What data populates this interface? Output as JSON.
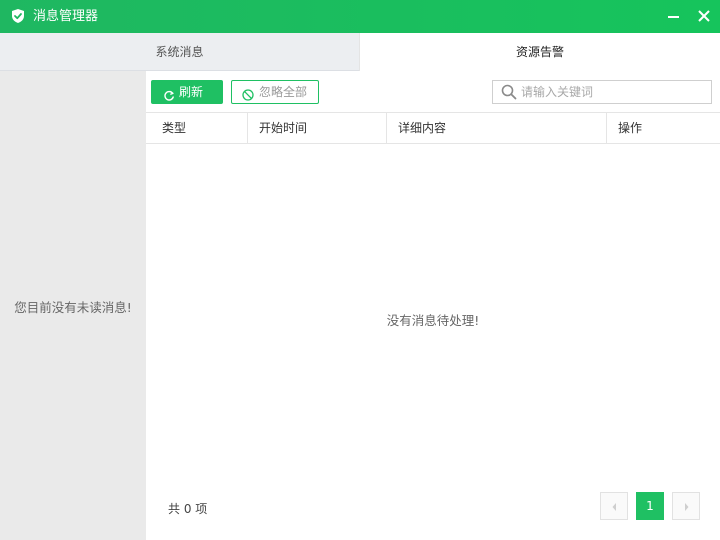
{
  "window": {
    "title": "消息管理器",
    "accent_color": "#1fc063",
    "icons": {
      "app": "shield-check-icon",
      "minimize": "minimize-icon",
      "close": "close-icon"
    }
  },
  "tabs": [
    {
      "label": "系统消息",
      "active": false
    },
    {
      "label": "资源告警",
      "active": true
    }
  ],
  "left_panel": {
    "empty_text": "您目前没有未读消息!"
  },
  "toolbar": {
    "refresh_label": "刷新",
    "refresh_icon": "refresh-icon",
    "ignore_all_label": "忽略全部",
    "ignore_icon": "ban-icon",
    "search_placeholder": "请输入关键词",
    "search_icon": "search-icon"
  },
  "table": {
    "columns": [
      "类型",
      "开始时间",
      "详细内容",
      "操作"
    ],
    "rows": [],
    "empty_text": "没有消息待处理!"
  },
  "footer": {
    "total_text": "共 0 项",
    "pagination": {
      "current_page": "1",
      "prev_icon": "chevron-left-icon",
      "next_icon": "chevron-right-icon"
    }
  }
}
